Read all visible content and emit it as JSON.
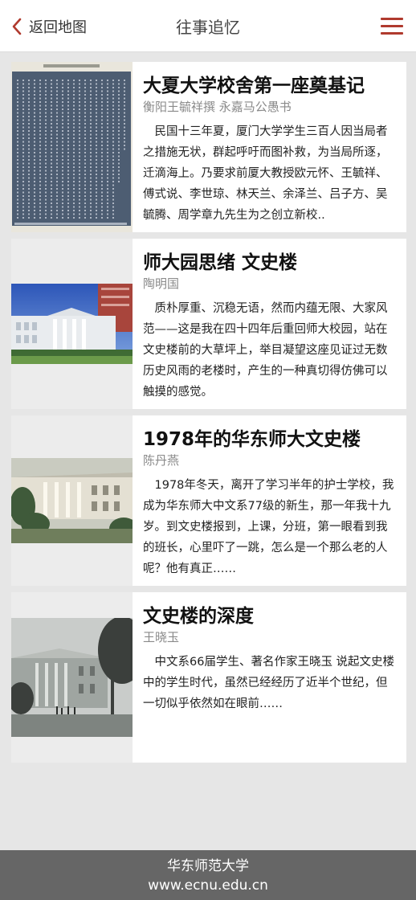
{
  "header": {
    "back_label": "返回地图",
    "title": "往事追忆",
    "accent_color": "#b03a2e"
  },
  "articles": [
    {
      "title": "大夏大学校舍第一座奠基记",
      "author": "衡阳王毓祥撰 永嘉马公愚书",
      "excerpt": "民国十三年夏，厦门大学学生三百人因当局者之措施无状，群起呼吁而图补救，为当局所逐，迁滴海上。乃要求前厦大教授欧元怀、王毓祥、傅式说、李世琼、林天兰、余泽兰、吕子方、吴毓腾、周学章九先生为之创立新校..",
      "image": "calligraphy-inscription"
    },
    {
      "title": "师大园思绪 文史楼",
      "author": "陶明国",
      "excerpt": "质朴厚重、沉稳无语，然而内蕴无限、大家风范——这是我在四十四年后重回师大校园，站在文史楼前的大草坪上，举目凝望这座见证过无数历史风雨的老楼时，产生的一种真切得仿佛可以触摸的感觉。",
      "image": "building-color-photo"
    },
    {
      "title": "1978年的华东师大文史楼",
      "author": "陈丹燕",
      "excerpt": "1978年冬天，离开了学习半年的护士学校，我成为华东师大中文系77级的新生，那一年我十九岁。到文史楼报到，上课，分班，第一眼看到我的班长，心里吓了一跳，怎么是一个那么老的人呢？他有真正……",
      "image": "building-vintage-photo"
    },
    {
      "title": "文史楼的深度",
      "author": "王晓玉",
      "excerpt": "中文系66届学生、著名作家王晓玉 说起文史楼中的学生时代，虽然已经经历了近半个世纪，但一切似乎依然如在眼前……",
      "image": "building-bw-photo"
    }
  ],
  "footer": {
    "name": "华东师范大学",
    "url": "www.ecnu.edu.cn"
  }
}
